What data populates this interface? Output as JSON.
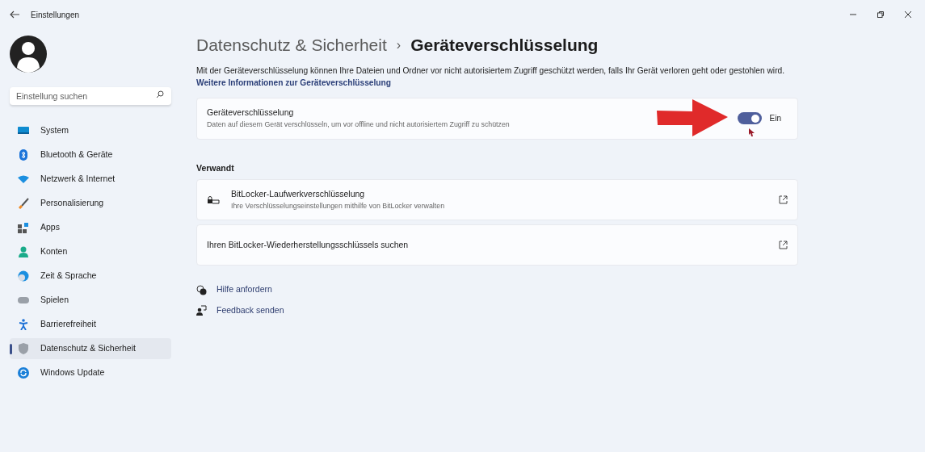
{
  "window": {
    "title": "Einstellungen"
  },
  "search": {
    "placeholder": "Einstellung suchen"
  },
  "sidebar": {
    "items": [
      {
        "label": "System",
        "selected": false
      },
      {
        "label": "Bluetooth & Geräte",
        "selected": false
      },
      {
        "label": "Netzwerk & Internet",
        "selected": false
      },
      {
        "label": "Personalisierung",
        "selected": false
      },
      {
        "label": "Apps",
        "selected": false
      },
      {
        "label": "Konten",
        "selected": false
      },
      {
        "label": "Zeit & Sprache",
        "selected": false
      },
      {
        "label": "Spielen",
        "selected": false
      },
      {
        "label": "Barrierefreiheit",
        "selected": false
      },
      {
        "label": "Datenschutz & Sicherheit",
        "selected": true
      },
      {
        "label": "Windows Update",
        "selected": false
      }
    ]
  },
  "breadcrumb": {
    "parent": "Datenschutz & Sicherheit",
    "separator": "›",
    "current": "Geräteverschlüsselung"
  },
  "description": "Mit der Geräteverschlüsselung können Ihre Dateien und Ordner vor nicht autorisiertem Zugriff geschützt werden, falls Ihr Gerät verloren geht oder gestohlen wird.",
  "info_link": "Weitere Informationen zur Geräteverschlüsselung",
  "setting": {
    "title": "Geräteverschlüsselung",
    "subtitle": "Daten auf diesem Gerät verschlüsseln, um vor offline und nicht autorisiertem Zugriff zu schützen",
    "on": true,
    "state_label": "Ein"
  },
  "related": {
    "heading": "Verwandt",
    "items": [
      {
        "title": "BitLocker-Laufwerkverschlüsselung",
        "subtitle": "Ihre Verschlüsselungseinstellungen mithilfe von BitLocker verwalten"
      },
      {
        "title": "Ihren BitLocker-Wiederherstellungsschlüssels suchen"
      }
    ]
  },
  "help_links": [
    "Hilfe anfordern",
    "Feedback senden"
  ]
}
